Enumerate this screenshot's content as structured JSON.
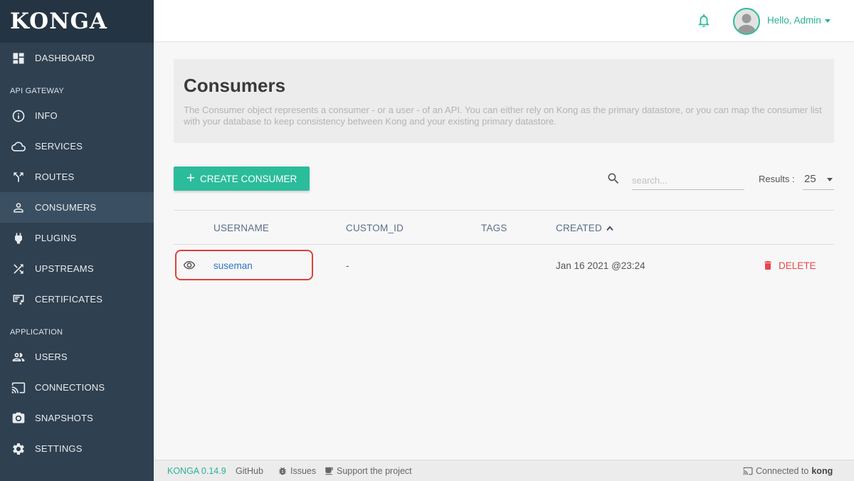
{
  "sidebar": {
    "logo": "KONGA",
    "dashboard": "DASHBOARD",
    "section_api": "API GATEWAY",
    "api_items": [
      {
        "label": "INFO",
        "icon": "info-icon"
      },
      {
        "label": "SERVICES",
        "icon": "cloud-icon"
      },
      {
        "label": "ROUTES",
        "icon": "routes-fork-icon"
      },
      {
        "label": "CONSUMERS",
        "icon": "user-icon"
      },
      {
        "label": "PLUGINS",
        "icon": "plug-icon"
      },
      {
        "label": "UPSTREAMS",
        "icon": "shuffle-icon"
      },
      {
        "label": "CERTIFICATES",
        "icon": "certificate-icon"
      }
    ],
    "section_app": "APPLICATION",
    "app_items": [
      {
        "label": "USERS",
        "icon": "users-icon"
      },
      {
        "label": "CONNECTIONS",
        "icon": "cast-icon"
      },
      {
        "label": "SNAPSHOTS",
        "icon": "camera-icon"
      },
      {
        "label": "SETTINGS",
        "icon": "gear-icon"
      }
    ],
    "active": "CONSUMERS"
  },
  "topbar": {
    "greeting": "Hello, Admin"
  },
  "hero": {
    "title": "Consumers",
    "description": "The Consumer object represents a consumer - or a user - of an API. You can either rely on Kong as the primary datastore, or you can map the consumer list with your database to keep consistency between Kong and your existing primary datastore."
  },
  "toolbar": {
    "create_label": "CREATE CONSUMER",
    "search_placeholder": "search...",
    "results_label": "Results :",
    "results_value": "25"
  },
  "table": {
    "columns": [
      "USERNAME",
      "CUSTOM_ID",
      "TAGS",
      "CREATED"
    ],
    "rows": [
      {
        "username": "suseman",
        "custom_id": "-",
        "tags": "",
        "created": "Jan 16 2021 @23:24",
        "delete": "DELETE"
      }
    ]
  },
  "footer": {
    "version": "KONGA 0.14.9",
    "github": "GitHub",
    "issues": "Issues",
    "support": "Support the project",
    "connected": "Connected to",
    "connected_target": "kong"
  },
  "colors": {
    "sidebar_bg": "#2f4050",
    "accent": "#2bbc9b",
    "link": "#2b77c4",
    "danger": "#e8464e",
    "highlight": "#e0403a"
  }
}
